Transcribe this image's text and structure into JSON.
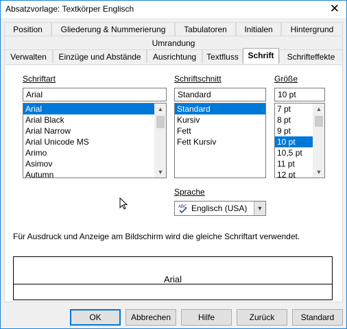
{
  "window": {
    "title": "Absatzvorlage: Textkörper Englisch",
    "close_label": "✕"
  },
  "tabs": {
    "row1": [
      "Position",
      "Gliederung & Nummerierung",
      "Tabulatoren",
      "Initialen",
      "Hintergrund"
    ],
    "row2": [
      "Umrandung"
    ],
    "row3": [
      "Verwalten",
      "Einzüge und Abstände",
      "Ausrichtung",
      "Textfluss",
      "Schrift",
      "Schrifteffekte"
    ],
    "active": "Schrift"
  },
  "font": {
    "label": "Schriftart",
    "value": "Arial",
    "items": [
      "Arial",
      "Arial Black",
      "Arial Narrow",
      "Arial Unicode MS",
      "Arimo",
      "Asimov",
      "Autumn"
    ],
    "selected": "Arial"
  },
  "style": {
    "label": "Schriftschnitt",
    "value": "Standard",
    "items": [
      "Standard",
      "Kursiv",
      "Fett",
      "Fett Kursiv"
    ],
    "selected": "Standard"
  },
  "size": {
    "label": "Größe",
    "value": "10 pt",
    "items": [
      "7 pt",
      "8 pt",
      "9 pt",
      "10 pt",
      "10,5 pt",
      "11 pt",
      "12 pt"
    ],
    "selected": "10 pt"
  },
  "language": {
    "label": "Sprache",
    "value": "Englisch (USA)",
    "icon": "spellcheck-icon"
  },
  "info_text": "Für Ausdruck und Anzeige am Bildschirm wird die gleiche Schriftart verwendet.",
  "preview": {
    "text": "Arial"
  },
  "buttons": {
    "ok": "OK",
    "cancel": "Abbrechen",
    "help": "Hilfe",
    "back": "Zurück",
    "standard": "Standard"
  },
  "colors": {
    "selection": "#0078d7",
    "accent_border": "#1883d7"
  }
}
